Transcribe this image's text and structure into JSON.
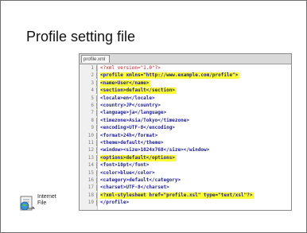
{
  "slide": {
    "title": "Profile setting file"
  },
  "editor": {
    "tab_label": "profile.xml",
    "lines": [
      {
        "n": "1",
        "text": "<?xml version=\"1.0\"?>",
        "highlight": false
      },
      {
        "n": "2",
        "text": "<profile xmlns=\"http://www.example.com/profile\">",
        "highlight": true
      },
      {
        "n": "3",
        "text": "  <name>User</name>",
        "highlight": true
      },
      {
        "n": "4",
        "text": "  <section>default</section>",
        "highlight": true
      },
      {
        "n": "5",
        "text": "  <locale>en</locale>",
        "highlight": false
      },
      {
        "n": "6",
        "text": "  <country>JP</country>",
        "highlight": false
      },
      {
        "n": "7",
        "text": "  <language>ja</language>",
        "highlight": false
      },
      {
        "n": "8",
        "text": "  <timezone>Asia/Tokyo</timezone>",
        "highlight": false
      },
      {
        "n": "9",
        "text": "  <encoding>UTF-8</encoding>",
        "highlight": false
      },
      {
        "n": "10",
        "text": "  <format>24h</format>",
        "highlight": false
      },
      {
        "n": "11",
        "text": "  <theme>default</theme>",
        "highlight": false
      },
      {
        "n": "12",
        "text": "  <window><size>1024x768</size></window>",
        "highlight": false
      },
      {
        "n": "13",
        "text": "  <options>default</options>",
        "highlight": true
      },
      {
        "n": "14",
        "text": "  <font>10pt</font>",
        "highlight": false
      },
      {
        "n": "15",
        "text": "  <color>blue</color>",
        "highlight": false
      },
      {
        "n": "16",
        "text": "  <category>default</category>",
        "highlight": false
      },
      {
        "n": "17",
        "text": "  <charset>UTF-8</charset>",
        "highlight": false
      },
      {
        "n": "18",
        "text": "  <?xml-stylesheet href=\"profile.xsl\" type=\"text/xsl\"?>",
        "highlight": true
      },
      {
        "n": "19",
        "text": "</profile>",
        "highlight": false
      }
    ]
  },
  "attachment": {
    "label_line1": "Internet",
    "label_line2": "File"
  }
}
